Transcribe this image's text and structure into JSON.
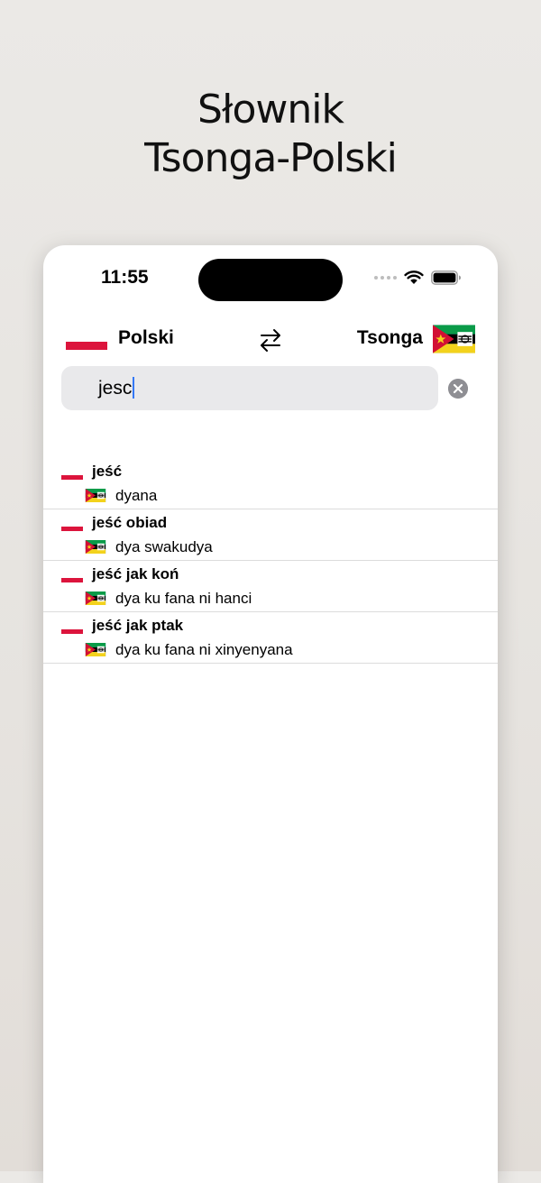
{
  "headline": {
    "line1": "Słownik",
    "line2": "Tsonga-Polski"
  },
  "status_bar": {
    "time": "11:55",
    "icons": [
      "signal-dots-icon",
      "wifi-icon",
      "battery-icon"
    ]
  },
  "language_bar": {
    "source_language": "Polski",
    "target_language": "Tsonga",
    "swap_icon": "swap-arrows-icon"
  },
  "search": {
    "value": "jesc",
    "clear_icon": "clear-x-icon"
  },
  "results": [
    {
      "source": "jeść",
      "translation": "dyana"
    },
    {
      "source": "jeść obiad",
      "translation": "dya swakudya"
    },
    {
      "source": "jeść jak koń",
      "translation": "dya ku fana ni hanci"
    },
    {
      "source": "jeść jak ptak",
      "translation": "dya ku fana ni xinyenyana"
    }
  ],
  "colors": {
    "polish_red": "#dc143c",
    "caret_blue": "#3478f6",
    "search_bg": "#e9e9eb"
  }
}
